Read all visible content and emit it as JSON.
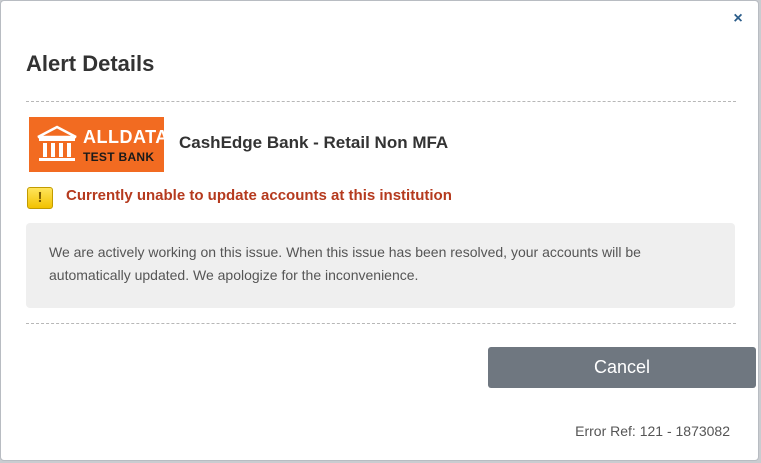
{
  "dialog": {
    "title": "Alert Details",
    "close_label": "×"
  },
  "institution": {
    "logo_line1": "ALLDATA",
    "logo_line2": "TEST BANK",
    "logo_icon": "bank-building-icon",
    "name": "CashEdge Bank - Retail Non MFA"
  },
  "alert": {
    "icon": "warning-icon",
    "icon_glyph": "!",
    "headline": "Currently unable to update accounts at this institution",
    "message": "We are actively working on this issue. When this issue has been resolved, your accounts will be automatically updated. We apologize for the inconvenience."
  },
  "actions": {
    "cancel_label": "Cancel"
  },
  "footer": {
    "error_ref": "Error Ref: 121 - 1873082"
  },
  "colors": {
    "logo_bg": "#f26b21",
    "alert_text": "#b53a1e",
    "button_bg": "#6f7780",
    "close_icon": "#2b5d8a"
  }
}
